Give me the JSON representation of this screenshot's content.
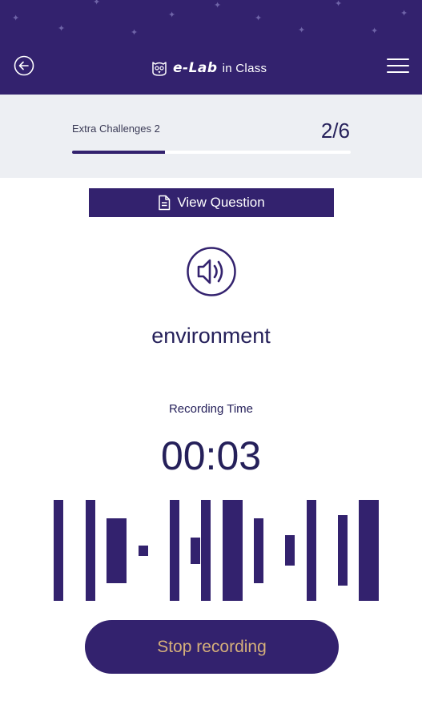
{
  "header": {
    "brand": "e-Lab",
    "brand_suffix": "in Class",
    "back_icon": "back-arrow-icon",
    "menu_icon": "hamburger-menu-icon",
    "background": "#33226e"
  },
  "progress": {
    "label": "Extra Challenges 2",
    "count_text": "2/6",
    "current": 2,
    "total": 6
  },
  "question": {
    "view_button_label": "View Question",
    "button_icon": "document-icon",
    "audio_icon": "speaker-icon",
    "word": "environment"
  },
  "recording": {
    "label": "Recording Time",
    "time": "00:03",
    "waveform_levels": [
      1,
      1,
      0.64,
      0.1,
      1,
      0.26,
      1,
      1,
      0.64,
      0.3,
      1,
      0.7,
      1
    ],
    "stop_label": "Stop recording"
  },
  "colors": {
    "primary": "#33226e",
    "stop_text": "#d6b07a",
    "text_dark": "#25205a",
    "progress_bg": "#edeff3"
  }
}
